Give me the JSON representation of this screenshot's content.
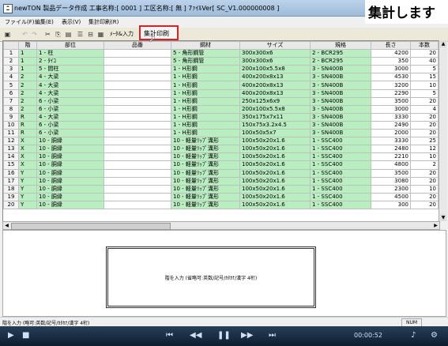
{
  "window": {
    "title": "newTON 製品データ作成  工事名称:[ 0001 ] 工区名称:[ 無 ] 7ｧｲﾙVer[ SC_V1.000000008 ]"
  },
  "overlay": {
    "caption": "集計します"
  },
  "menu": [
    "ファイル(F)",
    "編集(E)",
    "表示(V)",
    "集計印刷(R)"
  ],
  "toolbar": {
    "member_input": "ﾒｰﾀ&入力",
    "print_button": "集計印刷"
  },
  "table": {
    "headers": [
      "",
      "階",
      "部位",
      "品番",
      "鋼材",
      "サイズ",
      "規格",
      "長さ",
      "本数"
    ],
    "rows": [
      [
        "1",
        "1",
        "1 - 柱",
        "",
        "5 - 角形鋼管",
        "300x300x6",
        "2 - BCR295",
        "4200",
        "20"
      ],
      [
        "2",
        "1",
        "2 - ﾀｲｺ",
        "",
        "5 - 角形鋼管",
        "300x300x6",
        "2 - BCR295",
        "350",
        "40"
      ],
      [
        "3",
        "1",
        "5 - 間柱",
        "",
        "1 - H形鋼",
        "200x100x5.5x8",
        "3 - SN400B",
        "3000",
        "5"
      ],
      [
        "4",
        "2",
        "4 - 大梁",
        "",
        "1 - H形鋼",
        "400x200x8x13",
        "3 - SN400B",
        "4530",
        "15"
      ],
      [
        "5",
        "2",
        "4 - 大梁",
        "",
        "1 - H形鋼",
        "400x200x8x13",
        "3 - SN400B",
        "3200",
        "10"
      ],
      [
        "6",
        "2",
        "4 - 大梁",
        "",
        "1 - H形鋼",
        "400x200x8x13",
        "3 - SN400B",
        "2290",
        "5"
      ],
      [
        "7",
        "2",
        "6 - 小梁",
        "",
        "1 - H形鋼",
        "250x125x6x9",
        "3 - SN400B",
        "3500",
        "20"
      ],
      [
        "8",
        "2",
        "6 - 小梁",
        "",
        "1 - H形鋼",
        "200x100x5.5x8",
        "3 - SN400B",
        "3000",
        "4"
      ],
      [
        "9",
        "R",
        "4 - 大梁",
        "",
        "1 - H形鋼",
        "350x175x7x11",
        "3 - SN400B",
        "3330",
        "20"
      ],
      [
        "10",
        "R",
        "6 - 小梁",
        "",
        "1 - H形鋼",
        "150x75x3.2x4.5",
        "3 - SN400B",
        "2490",
        "20"
      ],
      [
        "11",
        "R",
        "6 - 小梁",
        "",
        "1 - H形鋼",
        "100x50x5x7",
        "3 - SN400B",
        "2000",
        "20"
      ],
      [
        "12",
        "X",
        "10 - 胴縁",
        "",
        "10 - 軽量ﾘｯﾌﾟ溝形",
        "100x50x20x1.6",
        "1 - SSC400",
        "3330",
        "25"
      ],
      [
        "13",
        "X",
        "10 - 胴縁",
        "",
        "10 - 軽量ﾘｯﾌﾟ溝形",
        "100x50x20x1.6",
        "1 - SSC400",
        "2480",
        "12"
      ],
      [
        "14",
        "X",
        "10 - 胴縁",
        "",
        "10 - 軽量ﾘｯﾌﾟ溝形",
        "100x50x20x1.6",
        "1 - SSC400",
        "2210",
        "10"
      ],
      [
        "15",
        "X",
        "10 - 胴縁",
        "",
        "10 - 軽量ﾘｯﾌﾟ溝形",
        "100x50x20x1.6",
        "1 - SSC400",
        "4800",
        "2"
      ],
      [
        "16",
        "Y",
        "10 - 胴縁",
        "",
        "10 - 軽量ﾘｯﾌﾟ溝形",
        "100x50x20x1.6",
        "1 - SSC400",
        "3500",
        "20"
      ],
      [
        "17",
        "Y",
        "10 - 胴縁",
        "",
        "10 - 軽量ﾘｯﾌﾟ溝形",
        "100x50x20x1.6",
        "1 - SSC400",
        "3080",
        "20"
      ],
      [
        "18",
        "Y",
        "10 - 胴縁",
        "",
        "10 - 軽量ﾘｯﾌﾟ溝形",
        "100x50x20x1.6",
        "1 - SSC400",
        "2300",
        "10"
      ],
      [
        "19",
        "Y",
        "10 - 胴縁",
        "",
        "10 - 軽量ﾘｯﾌﾟ溝形",
        "100x50x20x1.6",
        "1 - SSC400",
        "4500",
        "20"
      ],
      [
        "20",
        "Y",
        "10 - 胴縁",
        "",
        "10 - 軽量ﾘｯﾌﾟ溝形",
        "100x50x20x1.6",
        "1 - SSC400",
        "300",
        "20"
      ]
    ]
  },
  "preview": {
    "hint": "階を入力 (省略可:英数/記号/ｶﾀｶﾅ/漢字 4桁)"
  },
  "status": {
    "text": "階を入力 (略可:英数/記号/ｶﾀｶﾅ/漢字 4桁)",
    "num": "NUM"
  },
  "player": {
    "time": "00:00:52"
  }
}
